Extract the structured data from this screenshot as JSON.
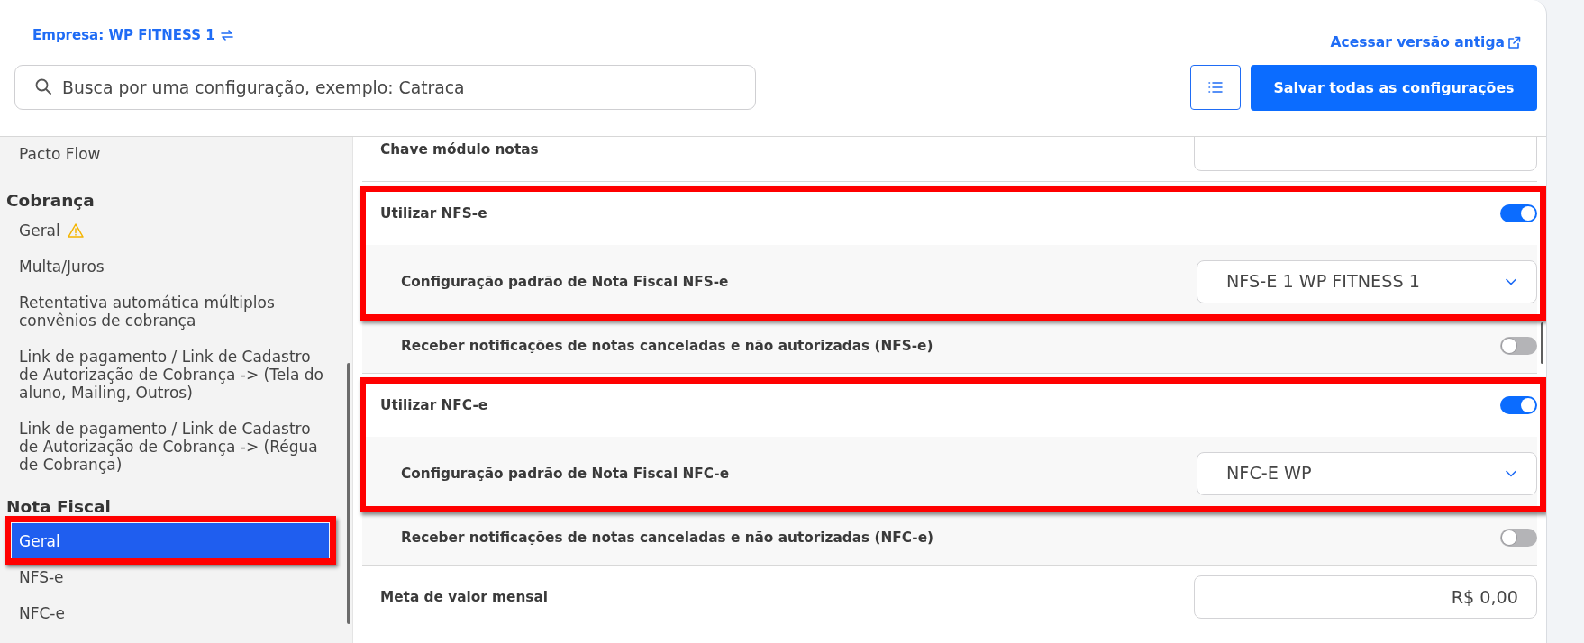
{
  "header": {
    "company_link": "Empresa: WP FITNESS 1",
    "old_version_link": "Acessar versão antiga",
    "search": {
      "placeholder": "Busca por uma configuração, exemplo: Catraca"
    },
    "save_button": "Salvar todas as configurações"
  },
  "sidebar": {
    "sections": [
      {
        "items": [
          {
            "label": "Pacto Flow",
            "selected": false,
            "warning": false,
            "highlighted": false
          }
        ]
      },
      {
        "title": "Cobrança",
        "items": [
          {
            "label": "Geral",
            "selected": false,
            "warning": true,
            "highlighted": false
          },
          {
            "label": "Multa/Juros",
            "selected": false,
            "warning": false,
            "highlighted": false
          },
          {
            "label": "Retentativa automática múltiplos convênios de cobrança",
            "selected": false,
            "warning": false,
            "highlighted": false
          },
          {
            "label": "Link de pagamento / Link de Cadastro de Autorização de Cobrança -> (Tela do aluno, Mailing, Outros)",
            "selected": false,
            "warning": false,
            "highlighted": false
          },
          {
            "label": "Link de pagamento / Link de Cadastro de Autorização de Cobrança -> (Régua de Cobrança)",
            "selected": false,
            "warning": false,
            "highlighted": false
          }
        ]
      },
      {
        "title": "Nota Fiscal",
        "items": [
          {
            "label": "Geral",
            "selected": true,
            "warning": false,
            "highlighted": true
          },
          {
            "label": "NFS-e",
            "selected": false,
            "warning": false,
            "highlighted": false
          },
          {
            "label": "NFC-e",
            "selected": false,
            "warning": false,
            "highlighted": false
          }
        ]
      }
    ]
  },
  "settings": [
    {
      "kind": "input",
      "label": "Chave módulo notas",
      "highlighted": false
    },
    {
      "kind": "toggle",
      "label": "Utilizar NFS-e",
      "on": true,
      "highlighted": true,
      "children": [
        {
          "kind": "select",
          "label": "Configuração padrão de Nota Fiscal NFS-e",
          "value": "NFS-E 1 WP FITNESS 1",
          "highlighted": true
        },
        {
          "kind": "toggle",
          "label": "Receber notificações de notas canceladas e não autorizadas (NFS-e)",
          "on": false,
          "highlighted": false
        }
      ]
    },
    {
      "kind": "toggle",
      "label": "Utilizar NFC-e",
      "on": true,
      "highlighted": true,
      "children": [
        {
          "kind": "select",
          "label": "Configuração padrão de Nota Fiscal NFC-e",
          "value": "NFC-E WP",
          "highlighted": true
        },
        {
          "kind": "toggle",
          "label": "Receber notificações de notas canceladas e não autorizadas (NFC-e)",
          "on": false,
          "highlighted": false
        }
      ]
    },
    {
      "kind": "input",
      "label": "Meta de valor mensal",
      "value": "R$ 0,00",
      "highlighted": false
    }
  ]
}
